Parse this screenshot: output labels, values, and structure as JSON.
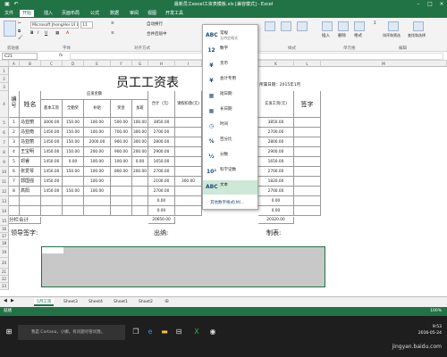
{
  "window": {
    "title": "最新员工excel工资表模板.xls [兼容模式] - Excel"
  },
  "tabs": [
    "文件",
    "开始",
    "插入",
    "页面布局",
    "公式",
    "数据",
    "审阅",
    "视图",
    "开发工具"
  ],
  "active_tab": "开始",
  "ribbon": {
    "font_name": "Microsoft JhengHei UI L",
    "font_size": "11",
    "wrap_label": "自动换行",
    "merge_label": "合并后居中",
    "groups": {
      "clipboard": "剪贴板",
      "font": "字体",
      "alignment": "对齐方式",
      "styles": "样式",
      "cells": "单元格",
      "editing": "编辑"
    },
    "right_buttons": [
      "插入",
      "删除",
      "格式",
      "排序和筛选",
      "查找和选择"
    ]
  },
  "formula_bar": {
    "name_box": "C21",
    "fx": "fx"
  },
  "columns": [
    "A",
    "B",
    "C",
    "D",
    "E",
    "F",
    "G",
    "H",
    "I",
    "J",
    "K",
    "L",
    "M"
  ],
  "sheet": {
    "title": "员工工资表",
    "company": "2 所属日期：2015年1月",
    "header": {
      "no": "编号",
      "name": "姓名",
      "salary_group": "应发金额",
      "basic": "基本工资",
      "allowance": "全勤奖",
      "subsidy": "补贴",
      "bonus": "奖金",
      "overtime": "加班",
      "total": "合计（元）",
      "deduct": "请假扣款(元)",
      "actual": "实发工资(元)",
      "sign": "签字"
    },
    "rows": [
      {
        "no": "1",
        "name": "马亚丽",
        "basic": "3000.00",
        "allowance": "150.00",
        "subsidy": "100.00",
        "bonus": "500.00",
        "overtime": "100.00",
        "total": "3850.00",
        "actual": "3850.00"
      },
      {
        "no": "2",
        "name": "马亚南",
        "basic": "1450.00",
        "allowance": "150.00",
        "subsidy": "100.00",
        "bonus": "700.00",
        "overtime": "300.00",
        "total": "2700.00",
        "actual": "2700.00"
      },
      {
        "no": "3",
        "name": "马亚丽",
        "basic": "1450.00",
        "allowance": "150.00",
        "subsidy": "2000.00",
        "bonus": "900.00",
        "overtime": "300.00",
        "total": "2800.00",
        "actual": "2800.00"
      },
      {
        "no": "4",
        "name": "王宝明",
        "basic": "1450.00",
        "allowance": "150.00",
        "subsidy": "200.00",
        "bonus": "900.00",
        "overtime": "200.00",
        "total": "2900.00",
        "actual": "2900.00"
      },
      {
        "no": "5",
        "name": "邓睿",
        "basic": "1450.00",
        "allowance": "0.00",
        "subsidy": "100.00",
        "bonus": "100.00",
        "overtime": "0.00",
        "total": "1650.00",
        "actual": "1650.00"
      },
      {
        "no": "6",
        "name": "张爱琴",
        "basic": "1450.00",
        "allowance": "150.00",
        "subsidy": "100.00",
        "bonus": "800.00",
        "overtime": "200.00",
        "total": "2700.00",
        "actual": "2700.00"
      },
      {
        "no": "7",
        "name": "郭国强",
        "basic": "1450.00",
        "allowance": "",
        "subsidy": "100.00",
        "bonus": "",
        "overtime": "",
        "total": "2100.00",
        "deduct": "300.00",
        "actual": "1820.00"
      },
      {
        "no": "8",
        "name": "高阳",
        "basic": "1450.00",
        "allowance": "150.00",
        "subsidy": "100.00",
        "bonus": "",
        "overtime": "",
        "total": "2700.00",
        "actual": "2700.00"
      },
      {
        "no": "",
        "name": "",
        "total": "0.00",
        "actual": "0.00"
      },
      {
        "no": "",
        "name": "",
        "total": "0.00",
        "actual": "0.00"
      }
    ],
    "subtotal_label": "分栏合计",
    "subtotal_total": "20650.00",
    "subtotal_actual": "20320.00",
    "leader": "领导签字:",
    "cashier": "出纳:",
    "preparer": "制表:"
  },
  "number_format_menu": {
    "items": [
      {
        "icon": "ABC",
        "label": "常规",
        "sub": "无特定格式"
      },
      {
        "icon": "12",
        "label": "数字",
        "sub": ""
      },
      {
        "icon": "¥",
        "label": "货币",
        "sub": ""
      },
      {
        "icon": "¥",
        "label": "会计专用",
        "sub": ""
      },
      {
        "icon": "▦",
        "label": "短日期",
        "sub": ""
      },
      {
        "icon": "▦",
        "label": "长日期",
        "sub": ""
      },
      {
        "icon": "◷",
        "label": "时间",
        "sub": ""
      },
      {
        "icon": "%",
        "label": "百分比",
        "sub": ""
      },
      {
        "icon": "½",
        "label": "分数",
        "sub": ""
      },
      {
        "icon": "10²",
        "label": "科学记数",
        "sub": ""
      },
      {
        "icon": "ABC",
        "label": "文本",
        "sub": ""
      }
    ],
    "selected_index": 10,
    "footer": "其他数字格式(M)..."
  },
  "sheet_tabs": [
    "5月工资",
    "Sheet3",
    "Sheet4",
    "Sheet1",
    "Sheet2"
  ],
  "active_sheet": "5月工资",
  "status": {
    "left": "就绪",
    "zoom": "100%"
  },
  "taskbar": {
    "search": "我是 Cortana，小娜。有问题尽管问我。",
    "time": "9:53",
    "date": "2016-05-24"
  },
  "watermark": "jingyan.baidu.com",
  "colors": {
    "accent": "#217346",
    "selection": "#c8c8c8"
  }
}
